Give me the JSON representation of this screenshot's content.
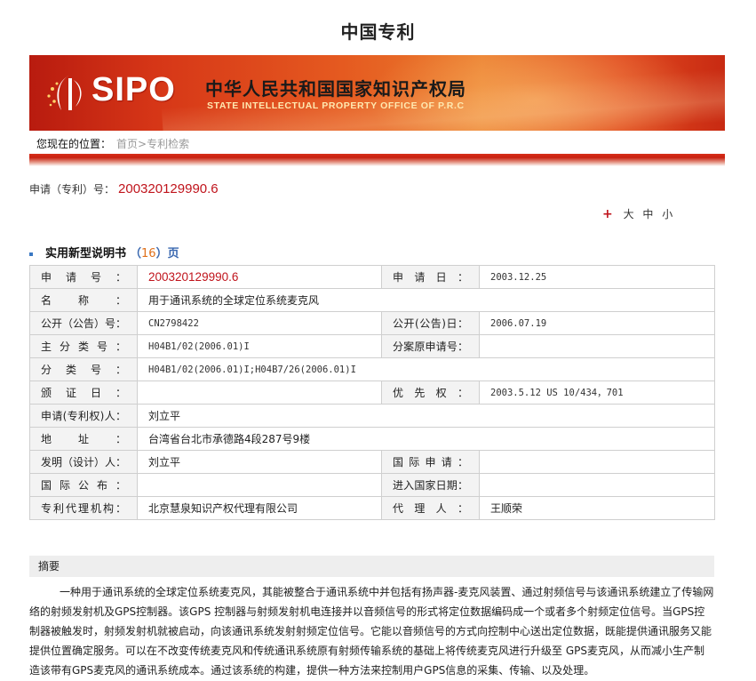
{
  "page": {
    "title": "中国专利"
  },
  "banner": {
    "logo_text": "SIPO",
    "cn_name": "中华人民共和国国家知识产权局",
    "en_name": "STATE INTELLECTUAL PROPERTY OFFICE OF P.R.C"
  },
  "breadcrumb": {
    "label": "您现在的位置：",
    "crumbs": "首页>专利检索"
  },
  "application": {
    "label": "申请（专利）号：",
    "number": "200320129990.6"
  },
  "font_size": {
    "plus": "+",
    "options": [
      "大",
      "中",
      "小"
    ]
  },
  "section": {
    "title": "实用新型说明书",
    "pages_open": "（",
    "pages_count": "16",
    "pages_close": "）页"
  },
  "table": {
    "rows": [
      {
        "k1": "申请号：",
        "v1": "200320129990.6",
        "k2": "申请日：",
        "v2": "2003.12.25"
      },
      {
        "k1": "名称：",
        "v1": "用于通讯系统的全球定位系统麦克风"
      },
      {
        "k1": "公开（公告）号：",
        "v1": "CN2798422",
        "k2": "公开(公告)日：",
        "v2": "2006.07.19"
      },
      {
        "k1": "主分类号：",
        "v1": "H04B1/02(2006.01)I",
        "k2": "分案原申请号：",
        "v2": ""
      },
      {
        "k1": "分类号：",
        "v1": "H04B1/02(2006.01)I;H04B7/26(2006.01)I"
      },
      {
        "k1": "颁证日：",
        "v1": "",
        "k2": "优先权：",
        "v2": "2003.5.12 US 10/434，701"
      },
      {
        "k1": "申请(专利权)人：",
        "v1": "刘立平"
      },
      {
        "k1": "地址：",
        "v1": "台湾省台北市承德路4段287号9楼"
      },
      {
        "k1": "发明（设计）人：",
        "v1": "刘立平",
        "k2": "国际申请：",
        "v2": ""
      },
      {
        "k1": "国际公布：",
        "v1": "",
        "k2": "进入国家日期：",
        "v2": ""
      },
      {
        "k1": "专利代理机构：",
        "v1": "北京慧泉知识产权代理有限公司",
        "k2": "代理人：",
        "v2": "王顺荣"
      }
    ]
  },
  "abstract": {
    "heading": "摘要",
    "text": "一种用于通讯系统的全球定位系统麦克风，其能被整合于通讯系统中并包括有扬声器-麦克风装置、通过射频信号与该通讯系统建立了传输网络的射频发射机及GPS控制器。该GPS 控制器与射频发射机电连接并以音频信号的形式将定位数据编码成一个或者多个射频定位信号。当GPS控制器被触发时，射频发射机就被启动，向该通讯系统发射射频定位信号。它能以音频信号的方式向控制中心送出定位数据，既能提供通讯服务又能提供位置确定服务。可以在不改变传统麦克风和传统通讯系统原有射频传输系统的基础上将传统麦克风进行升级至 GPS麦克风，从而减小生产制造该带有GPS麦克风的通讯系统成本。通过该系统的构建，提供一种方法来控制用户GPS信息的采集、传输、以及处理。"
  },
  "colors": {
    "accent_red": "#c0141c",
    "banner_red": "#d63617",
    "link_blue": "#3a68b0"
  }
}
